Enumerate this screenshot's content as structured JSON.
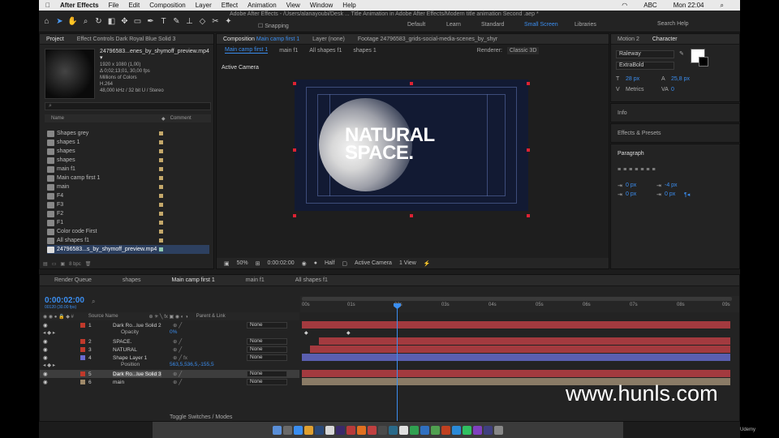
{
  "menubar": {
    "app": "After Effects",
    "items": [
      "File",
      "Edit",
      "Composition",
      "Layer",
      "Effect",
      "Animation",
      "View",
      "Window",
      "Help"
    ],
    "abc": "ABC",
    "clock": "Mon 22:04"
  },
  "window_title": "Adobe After Effects - /Users/alanayoubi/Desk ... Title Animation in Adobe After Effects/Modern title animation Second .aep *",
  "toolbar": {
    "snapping": "Snapping",
    "workspaces": [
      "Default",
      "Learn",
      "Standard",
      "Small Screen",
      "Libraries"
    ],
    "selected_workspace": "Small Screen",
    "search_placeholder": "Search Help"
  },
  "project": {
    "tab": "Project",
    "effect_controls_tab": "Effect Controls Dark Royal Blue Solid 3",
    "file": {
      "name": "24796583...enes_by_shymoff_preview.mp4 ▾",
      "res": "1920 x 1080 (1,00)",
      "duration": "Δ 0;02;13;01, 30,00 fps",
      "colors": "Millions of Colors",
      "codec": "H.264",
      "audio": "48,000 kHz / 32 bit U / Stereo"
    },
    "search_placeholder": "",
    "col_name": "Name",
    "col_comment": "Comment",
    "items": [
      "Shapes grey",
      "shapes 1",
      "shapes",
      "shapes",
      "main f1",
      "Main camp first 1",
      "main",
      "F4",
      "F3",
      "F2",
      "F1",
      "Color code First",
      "All shapes f1",
      "24796583...s_by_shymoff_preview.mp4"
    ],
    "bpc": "8 bpc"
  },
  "composition": {
    "tab_prefix": "Composition",
    "tab_name": "Main camp first 1",
    "layer_tab": "Layer (none)",
    "footage_tab": "Footage 24796583_grids-social-media-scenes_by_shyr",
    "breadcrumbs": [
      "Main camp first 1",
      "main f1",
      "All shapes f1",
      "shapes 1"
    ],
    "renderer_label": "Renderer:",
    "renderer_value": "Classic 3D",
    "active_camera": "Active Camera",
    "stage_title_line1": "NATURAL",
    "stage_title_line2": "SPACE.",
    "zoom": "50%",
    "timecode": "0:00:02:00",
    "resolution": "Half",
    "camera": "Active Camera",
    "views": "1 View"
  },
  "character": {
    "tab_motion": "Motion 2",
    "tab": "Character",
    "font": "Raleway",
    "style": "ExtraBold",
    "size": "28 px",
    "leading": "25,8 px",
    "kerning": "Metrics",
    "tracking": "0",
    "info": "Info",
    "effects": "Effects & Presets",
    "paragraph": "Paragraph",
    "indent_left": "0 px",
    "indent_first": "0 px",
    "space_before": "-4 px",
    "space_after": "0 px",
    "indent_right": "0 px"
  },
  "timeline": {
    "tabs": [
      "Render Queue",
      "shapes",
      "Main camp first 1",
      "main f1",
      "All shapes f1"
    ],
    "active_tab": "Main camp first 1",
    "current_time": "0:00:02:00",
    "fps": "00120 (30.00 fps)",
    "headers": {
      "source": "Source Name",
      "parent": "Parent & Link"
    },
    "ruler": [
      "00s",
      "01s",
      "02s",
      "03s",
      "04s",
      "05s",
      "06s",
      "07s",
      "08s",
      "09s"
    ],
    "layers": [
      {
        "num": "1",
        "name": "Dark Ro...lue Solid 2",
        "parent": "None",
        "color": "#c0392b"
      },
      {
        "num": "2",
        "name": "SPACE.",
        "parent": "None",
        "color": "#c0392b"
      },
      {
        "num": "3",
        "name": "NATURAL",
        "parent": "None",
        "color": "#c0392b"
      },
      {
        "num": "4",
        "name": "Shape Layer 1",
        "parent": "None",
        "color": "#6b6bd0"
      },
      {
        "num": "5",
        "name": "Dark Ro...lue Solid 3",
        "parent": "None",
        "color": "#c0392b"
      },
      {
        "num": "6",
        "name": "main",
        "parent": "None",
        "color": "#a08a6a"
      }
    ],
    "opacity_label": "Opacity",
    "opacity_value": "0%",
    "position_label": "Position",
    "position_value": "563,5,536,5,-155,5",
    "toggle": "Toggle Switches / Modes"
  },
  "watermark": "www.hunls.com",
  "udemy": "Udemy"
}
